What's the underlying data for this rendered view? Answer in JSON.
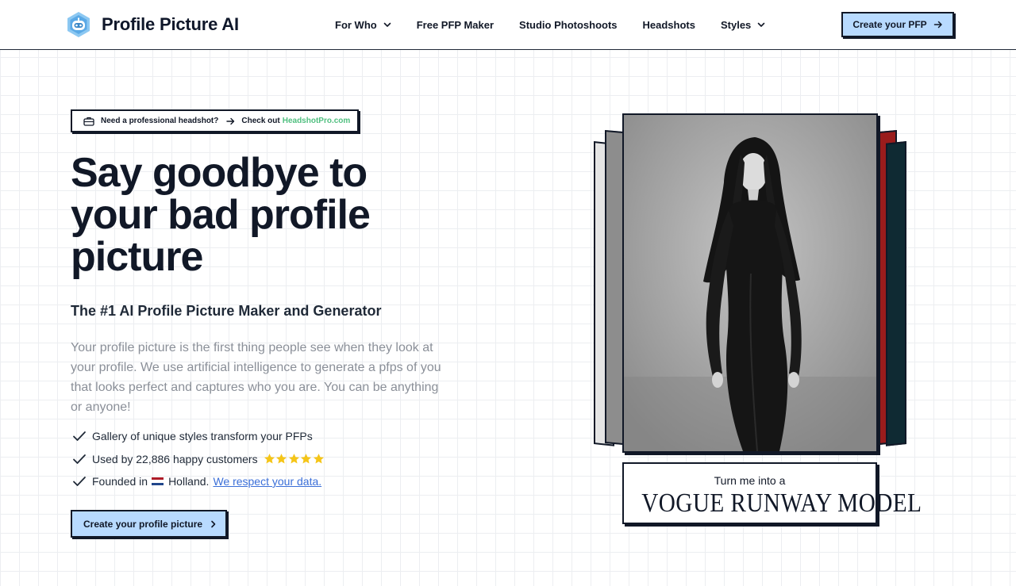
{
  "brand": {
    "name": "Profile Picture AI",
    "logo_icon": "robot-logo-icon"
  },
  "nav": {
    "items": [
      {
        "label": "For Who",
        "has_dropdown": true
      },
      {
        "label": "Free PFP Maker",
        "has_dropdown": false
      },
      {
        "label": "Studio Photoshoots",
        "has_dropdown": false
      },
      {
        "label": "Headshots",
        "has_dropdown": false
      },
      {
        "label": "Styles",
        "has_dropdown": true
      }
    ],
    "cta_label": "Create your PFP"
  },
  "banner": {
    "text": "Need a professional headshot?",
    "check_out": "Check out",
    "partner": "HeadshotPro.com"
  },
  "hero": {
    "headline": "Say goodbye to your bad profile picture",
    "subtitle": "The #1 AI Profile Picture Maker and Generator",
    "description": "Your profile picture is the first thing people see when they look at your profile. We use artificial intelligence to generate a pfps of you that looks perfect and captures who you are. You can be anything or anyone!",
    "features": {
      "gallery": "Gallery of unique styles transform your PFPs",
      "used_by": "Used by 22,886 happy customers",
      "rating_stars": 5,
      "founded_prefix": "Founded in",
      "founded_place": "Holland.",
      "data_link": "We respect your data."
    },
    "cta_label": "Create your profile picture"
  },
  "showcase": {
    "caption_line1": "Turn me into a",
    "caption_line2": "VOGUE RUNWAY MODEL"
  },
  "colors": {
    "accent_button": "#b8daff",
    "partner_green": "#4fbf7f",
    "link_blue": "#3b6fd8",
    "star_yellow": "#f5c518",
    "logo_blue": "#5aa9e6"
  }
}
